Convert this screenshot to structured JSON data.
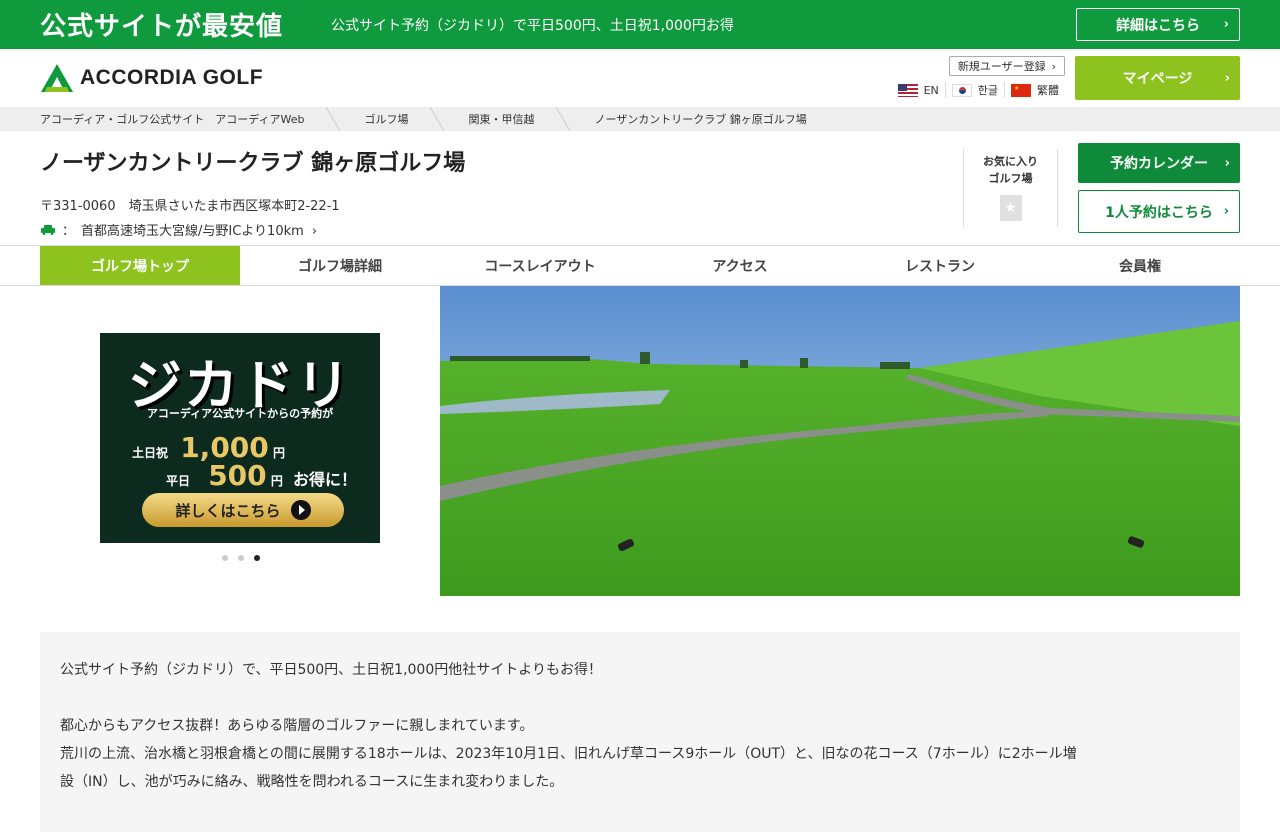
{
  "promo": {
    "headline": "公式サイトが最安値",
    "message": "公式サイト予約（ジカドリ）で平日500円、土日祝1,000円お得",
    "detail_label": "詳細はこちら"
  },
  "header": {
    "logo_text": "ACCORDIA GOLF",
    "register_label": "新規ユーザー登録",
    "languages": [
      {
        "code": "EN",
        "label": "EN"
      },
      {
        "code": "KO",
        "label": "한글"
      },
      {
        "code": "ZH",
        "label": "繁體"
      }
    ],
    "mypage_label": "マイページ"
  },
  "breadcrumb": [
    "アコーディア・ゴルフ公式サイト　アコーディアWeb",
    "ゴルフ場",
    "関東・甲信越",
    "ノーザンカントリークラブ 錦ヶ原ゴルフ場"
  ],
  "course": {
    "name": "ノーザンカントリークラブ 錦ヶ原ゴルフ場",
    "address": "〒331-0060　埼玉県さいたま市西区塚本町2-22-1",
    "access": "首都高速埼玉大宮線/与野ICより10km",
    "access_prefix": "：",
    "favorite_line1": "お気に入り",
    "favorite_line2": "ゴルフ場",
    "calendar_label": "予約カレンダー",
    "single_label": "1人予約はこちら"
  },
  "tabs": [
    {
      "label": "ゴルフ場トップ",
      "active": true
    },
    {
      "label": "ゴルフ場詳細",
      "active": false
    },
    {
      "label": "コースレイアウト",
      "active": false
    },
    {
      "label": "アクセス",
      "active": false
    },
    {
      "label": "レストラン",
      "active": false
    },
    {
      "label": "会員権",
      "active": false
    }
  ],
  "banner": {
    "title": "ジカドリ",
    "subtitle": "アコーディア公式サイトからの予約が",
    "weekend_label": "土日祝",
    "weekend_value": "1,000",
    "weekday_label": "平日",
    "weekday_value": "500",
    "yen": "円",
    "otoku": "お得に！",
    "button_label": "詳しくはこちら",
    "slide_count": 3,
    "active_slide": 3
  },
  "description": {
    "line1": "公式サイト予約（ジカドリ）で、平日500円、土日祝1,000円他社サイトよりもお得！",
    "line2": "都心からもアクセス抜群！あらゆる階層のゴルファーに親しまれています。",
    "line3": "荒川の上流、治水橋と羽根倉橋との間に展開する18ホールは、2023年10月1日、旧れんげ草コース9ホール（OUT）と、旧なの花コース（7ホール）に2ホール増",
    "line4": "設（IN）し、池が巧みに絡み、戦略性を問われるコースに生まれ変わりました。"
  },
  "colors": {
    "brand_green": "#0f9a3d",
    "accent_lime": "#8dc21f"
  }
}
